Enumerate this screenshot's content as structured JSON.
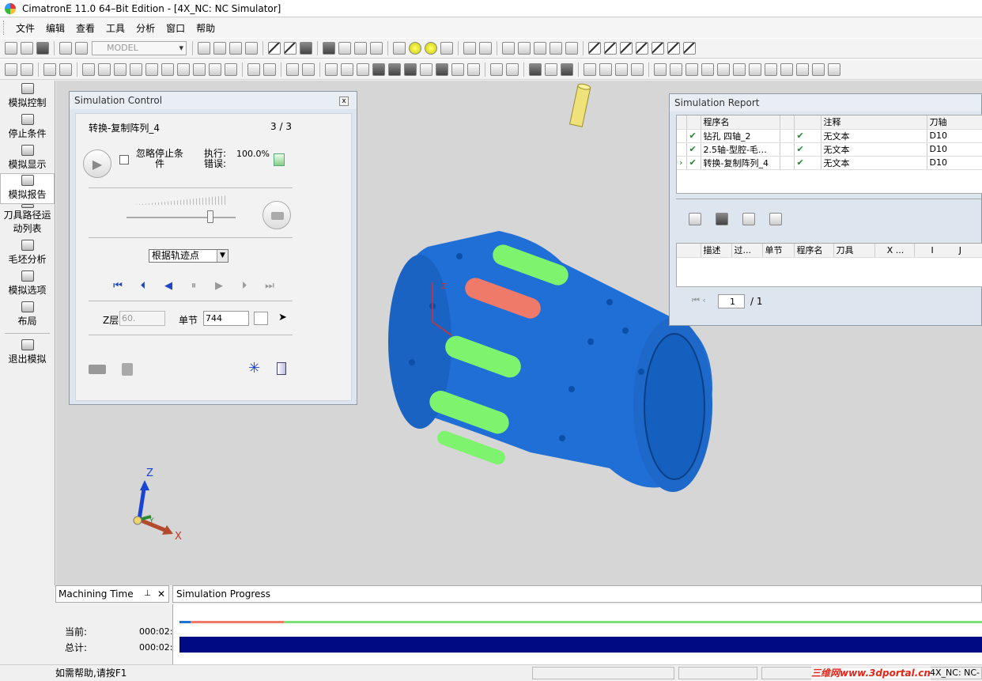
{
  "window": {
    "title": "CimatronE 11.0 64–Bit Edition - [4X_NC: NC Simulator]"
  },
  "menu": [
    "文件",
    "编辑",
    "查看",
    "工具",
    "分析",
    "窗口",
    "帮助"
  ],
  "toolbar": {
    "model_combo": "MODEL"
  },
  "left_panel": [
    {
      "label": "模拟控制",
      "icon": "simulation-control-icon"
    },
    {
      "label": "停止条件",
      "icon": "stop-condition-icon"
    },
    {
      "label": "模拟显示",
      "icon": "simulation-display-icon"
    },
    {
      "label": "模拟报告",
      "icon": "simulation-report-icon"
    },
    {
      "label": "刀具路径运",
      "label2": "动列表",
      "icon": "toolpath-list-icon"
    },
    {
      "label": "毛坯分析",
      "icon": "stock-analysis-icon"
    },
    {
      "label": "模拟选项",
      "icon": "simulation-options-icon"
    },
    {
      "label": "布局",
      "icon": "layout-icon"
    },
    {
      "label": "退出模拟",
      "icon": "exit-simulation-icon"
    }
  ],
  "sim_control": {
    "title": "Simulation Control",
    "procedure": "转换-复制阵列_4",
    "counter": "3 / 3",
    "ignore_stop_line1": "忽略停止条",
    "ignore_stop_line2": "件",
    "execute_label": "执行:",
    "execute_value": "100.0%",
    "error_label": "错误:",
    "mode_select": "根据轨迹点",
    "z_label": "Z层",
    "z_value": "60.",
    "step_label": "单节",
    "step_value": "744"
  },
  "sim_report": {
    "title": "Simulation Report",
    "columns": [
      "程序名",
      "注释",
      "刀轴"
    ],
    "rows": [
      {
        "name": "钻孔 四轴_2",
        "note": "无文本",
        "tool": "D10"
      },
      {
        "name": "2.5轴-型腔-毛…",
        "note": "无文本",
        "tool": "D10"
      },
      {
        "name": "转换-复制阵列_4",
        "note": "无文本",
        "tool": "D10"
      }
    ],
    "detail_columns": [
      "描述",
      "过...",
      "单节",
      "程序名",
      "刀具",
      "X ...",
      "I",
      "J"
    ],
    "page_value": "1",
    "page_total": "/ 1"
  },
  "axes": {
    "x": "X",
    "y": "Y",
    "z": "Z"
  },
  "machining_time": {
    "title": "Machining Time",
    "current_label": "当前:",
    "current_value": "000:02:",
    "total_label": "总计:",
    "total_value": "000:02:"
  },
  "sim_progress": {
    "title": "Simulation Progress",
    "progress": 1.0
  },
  "status": {
    "help": "如需帮助,请按F1",
    "right": "4X_NC: NC-",
    "watermark": "三维网www.3dportal.cn"
  },
  "colors": {
    "part_blue": "#1f6fd6",
    "pocket_green": "#7ef36e",
    "pocket_red": "#f07a6a",
    "progress_dark": "#000a82"
  }
}
